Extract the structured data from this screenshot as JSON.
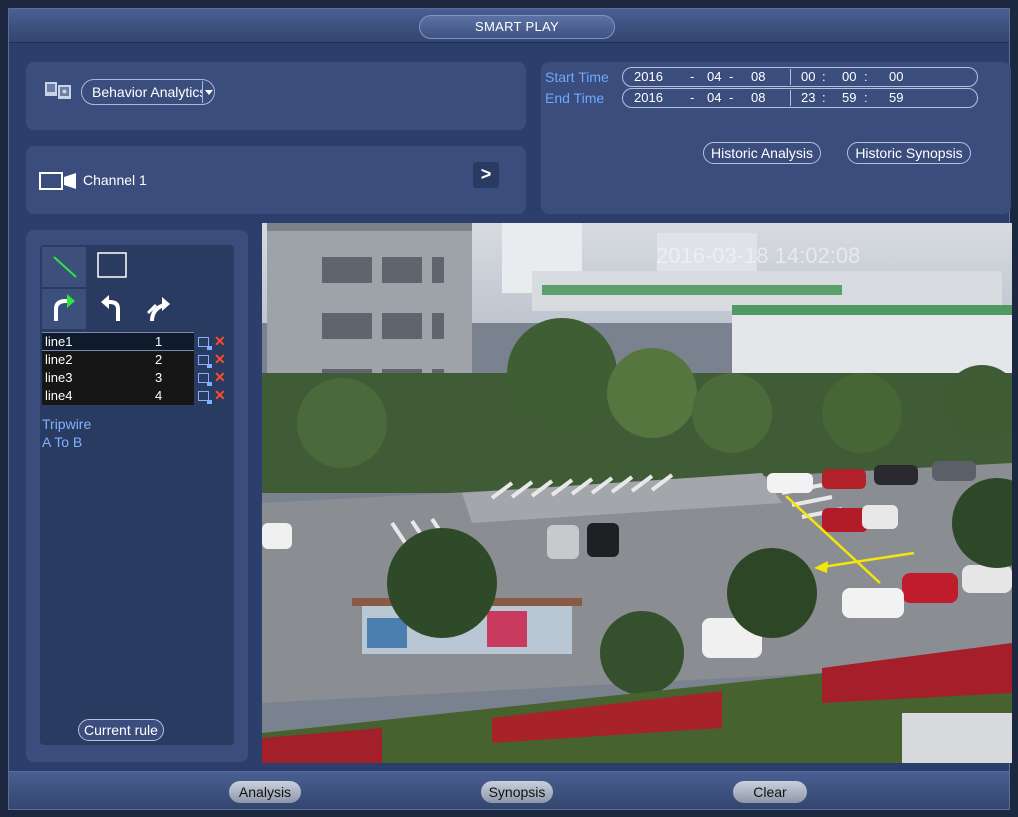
{
  "window": {
    "title": "SMART PLAY"
  },
  "analysis_type": {
    "selected": "Behavior Analytics"
  },
  "channel": {
    "label": "Channel 1"
  },
  "time_range": {
    "start_label": "Start Time",
    "end_label": "End Time",
    "start": {
      "year": "2016",
      "month": "04",
      "day": "08",
      "hour": "00",
      "minute": "00",
      "second": "00"
    },
    "end": {
      "year": "2016",
      "month": "04",
      "day": "08",
      "hour": "23",
      "minute": "59",
      "second": "59"
    },
    "date_separator": "-",
    "time_separator": ":"
  },
  "actions": {
    "historic_analysis": "Historic Analysis",
    "historic_synopsis": "Historic Synopsis"
  },
  "rule_tools": [
    "line-tool-icon",
    "rectangle-tool-icon",
    "redo-icon",
    "undo-icon",
    "reset-icon"
  ],
  "rules": [
    {
      "name": "line1",
      "num": "1"
    },
    {
      "name": "line2",
      "num": "2"
    },
    {
      "name": "line3",
      "num": "3"
    },
    {
      "name": "line4",
      "num": "4"
    }
  ],
  "rule_info": {
    "type": "Tripwire",
    "direction": "A To B"
  },
  "current_rule_button": "Current rule",
  "video": {
    "timestamp": "2016-03-18 14:02:08"
  },
  "bottom": {
    "analysis": "Analysis",
    "synopsis": "Synopsis",
    "clear": "Clear"
  },
  "colors": {
    "panel": "#3a4d7c",
    "frame": "#2c3f6c",
    "accent_text": "#6ea8ff",
    "delete": "#ff4a2a",
    "tripwire": "#f5e60a"
  }
}
